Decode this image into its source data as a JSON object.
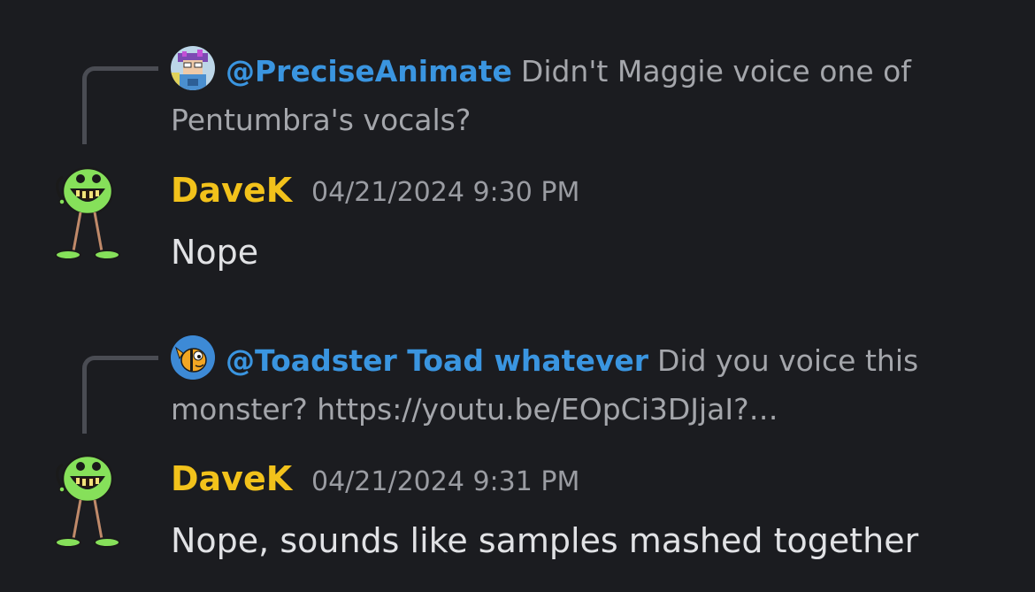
{
  "messages": [
    {
      "reply": {
        "author": "@PreciseAnimate",
        "text": "Didn't Maggie voice one of Pentumbra's vocals?",
        "avatar_icon": "pixel-art-avatar-icon"
      },
      "author": "DaveK",
      "timestamp": "04/21/2024 9:30 PM",
      "text": "Nope",
      "avatar_icon": "green-monster-avatar-icon"
    },
    {
      "reply": {
        "author": "@Toadster Toad whatever",
        "text": "Did you voice this monster? https://youtu.be/EOpCi3DJjaI?…",
        "avatar_icon": "cartoon-fish-avatar-icon"
      },
      "author": "DaveK",
      "timestamp": "04/21/2024 9:31 PM",
      "text": "Nope, sounds like samples mashed together",
      "avatar_icon": "green-monster-avatar-icon"
    }
  ],
  "colors": {
    "background": "#1b1c20",
    "author": "#f2c21b",
    "mention": "#3a95e0",
    "reply_text": "#a4a6ab",
    "message_text": "#e1e2e5",
    "timestamp": "#9a9ca2"
  }
}
